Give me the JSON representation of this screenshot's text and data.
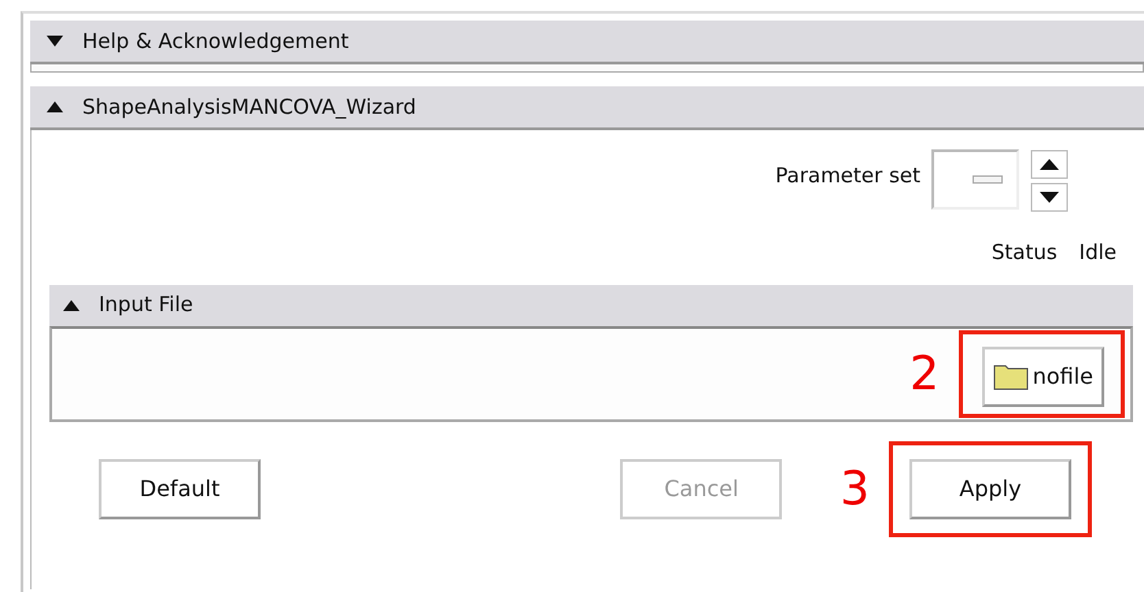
{
  "sections": [
    {
      "title": "Help & Acknowledgement",
      "expanded": false
    },
    {
      "title": "ShapeAnalysisMANCOVA_Wizard",
      "expanded": true
    }
  ],
  "parameter_set": {
    "label": "Parameter set"
  },
  "status": {
    "label": "Status",
    "value": "Idle"
  },
  "input_file": {
    "title": "Input File",
    "expanded": true,
    "button": "nofile",
    "callout": "2"
  },
  "buttons": [
    {
      "label": "Default",
      "disabled": false
    },
    {
      "label": "Cancel",
      "disabled": true
    },
    {
      "label": "Apply",
      "disabled": false,
      "callout": "3"
    }
  ]
}
